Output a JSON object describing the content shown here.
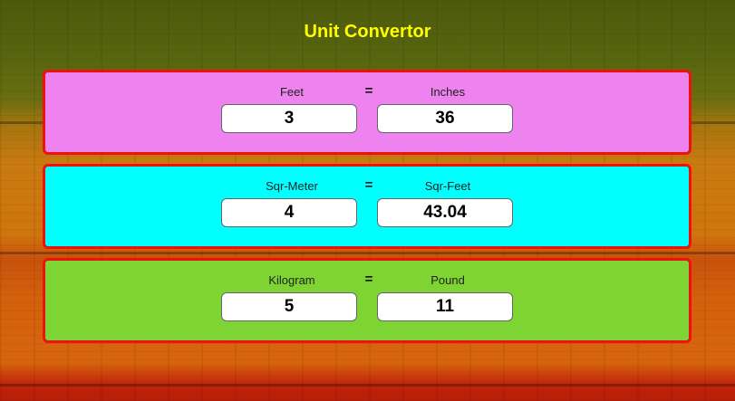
{
  "app": {
    "title": "Unit Convertor"
  },
  "converters": [
    {
      "from_unit": "Feet",
      "equals": "=",
      "to_unit": "Inches",
      "from_value": "3",
      "to_value": "36"
    },
    {
      "from_unit": "Sqr-Meter",
      "equals": "=",
      "to_unit": "Sqr-Feet",
      "from_value": "4",
      "to_value": "43.04"
    },
    {
      "from_unit": "Kilogram",
      "equals": "=",
      "to_unit": "Pound",
      "from_value": "5",
      "to_value": "11"
    }
  ],
  "colors": {
    "title": "#ffff00",
    "card_border": "#ee1111",
    "card_1_bg": "#ee82ee",
    "card_2_bg": "#00ffff",
    "card_3_bg": "#7ed432"
  }
}
